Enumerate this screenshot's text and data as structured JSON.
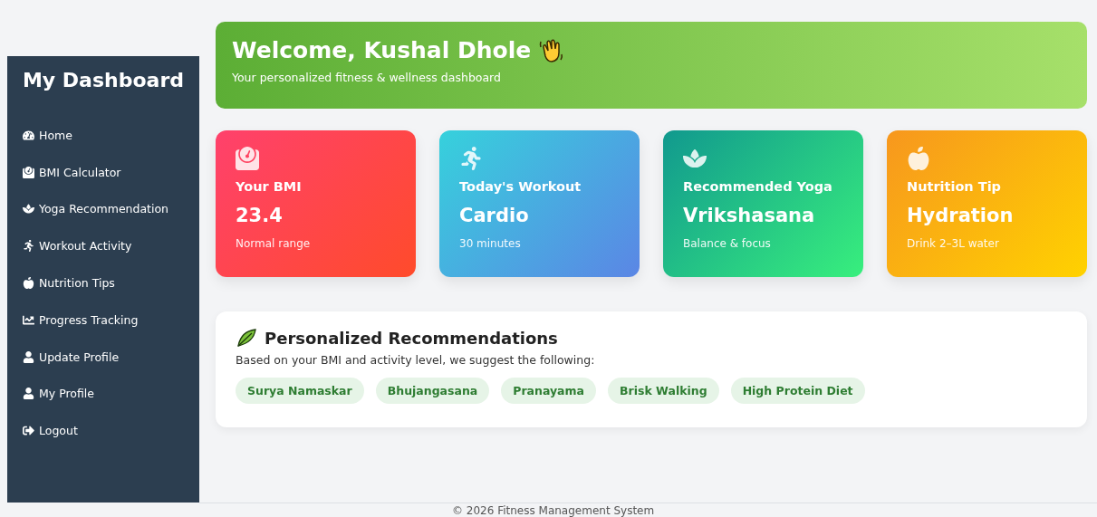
{
  "sidebar": {
    "title": "My Dashboard",
    "items": [
      {
        "label": "Home"
      },
      {
        "label": "BMI Calculator"
      },
      {
        "label": "Yoga Recommendation"
      },
      {
        "label": "Workout Activity"
      },
      {
        "label": "Nutrition Tips"
      },
      {
        "label": "Progress Tracking"
      },
      {
        "label": "Update Profile"
      },
      {
        "label": "My Profile"
      },
      {
        "label": "Logout"
      }
    ]
  },
  "banner": {
    "title": "Welcome, Kushal Dhole",
    "subtitle": "Your personalized fitness & wellness dashboard"
  },
  "cards": [
    {
      "kind": "bmi",
      "title": "Your BMI",
      "value": "23.4",
      "note": "Normal range"
    },
    {
      "kind": "workout",
      "title": "Today's Workout",
      "value": "Cardio",
      "note": "30 minutes"
    },
    {
      "kind": "yoga",
      "title": "Recommended Yoga",
      "value": "Vrikshasana",
      "note": "Balance & focus"
    },
    {
      "kind": "nutrition",
      "title": "Nutrition Tip",
      "value": "Hydration",
      "note": "Drink 2–3L water"
    }
  ],
  "recommendations": {
    "title": "Personalized Recommendations",
    "text": "Based on your BMI and activity level, we suggest the following:",
    "tags": [
      "Surya Namaskar",
      "Bhujangasana",
      "Pranayama",
      "Brisk Walking",
      "High Protein Diet"
    ]
  },
  "footer": "© 2026 Fitness Management System"
}
